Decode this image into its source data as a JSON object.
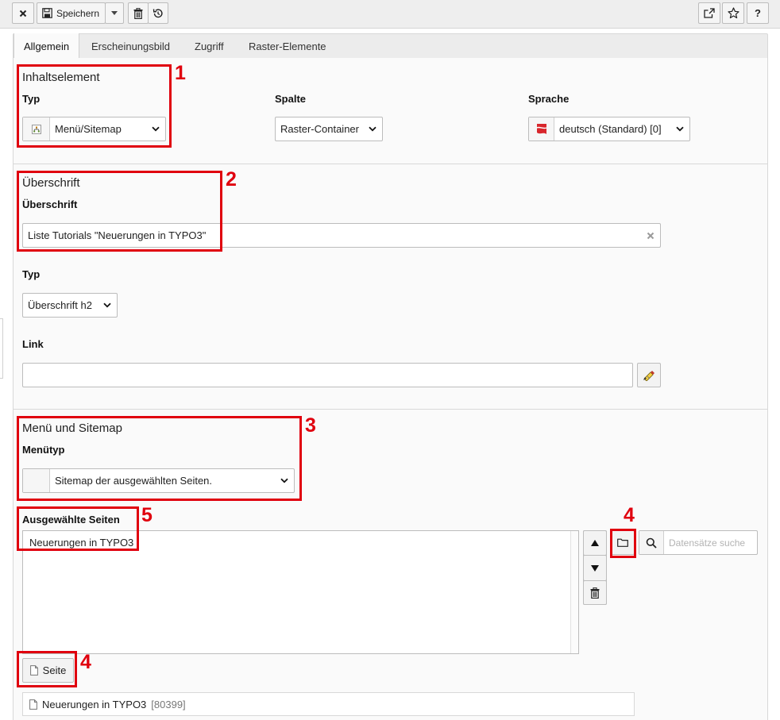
{
  "toolbar": {
    "close_icon": "close-icon",
    "save_label": "Speichern",
    "delete_icon": "trash-icon",
    "history_icon": "history-icon",
    "open_new_icon": "external-link-icon",
    "bookmark_icon": "star-icon",
    "help_label": "?"
  },
  "tabs": [
    {
      "label": "Allgemein",
      "active": true
    },
    {
      "label": "Erscheinungsbild",
      "active": false
    },
    {
      "label": "Zugriff",
      "active": false
    },
    {
      "label": "Raster-Elemente",
      "active": false
    }
  ],
  "section_content": {
    "title": "Inhaltselement",
    "type_label": "Typ",
    "type_value": "Menü/Sitemap",
    "column_label": "Spalte",
    "column_value": "Raster-Container",
    "language_label": "Sprache",
    "language_value": "deutsch (Standard) [0]"
  },
  "section_header": {
    "title": "Überschrift",
    "header_label": "Überschrift",
    "header_value": "Liste Tutorials \"Neuerungen in TYPO3\"",
    "type_label": "Typ",
    "type_value": "Überschrift h2",
    "link_label": "Link",
    "link_value": ""
  },
  "section_menu": {
    "title": "Menü und Sitemap",
    "menutype_label": "Menütyp",
    "menutype_value": "Sitemap der ausgewählten Seiten.",
    "pages_label": "Ausgewählte Seiten",
    "selected_items": [
      "Neuerungen in TYPO3"
    ],
    "search_placeholder": "Datensätze suche",
    "page_button_label": "Seite",
    "record_title": "Neuerungen in TYPO3",
    "record_uid": "[80399]"
  },
  "annotations": {
    "n1": "1",
    "n2": "2",
    "n3": "3",
    "n4a": "4",
    "n4b": "4",
    "n5": "5"
  },
  "colors": {
    "annotation": "#e0000e",
    "panel": "#fafafa",
    "toolbar": "#eeeeee"
  }
}
